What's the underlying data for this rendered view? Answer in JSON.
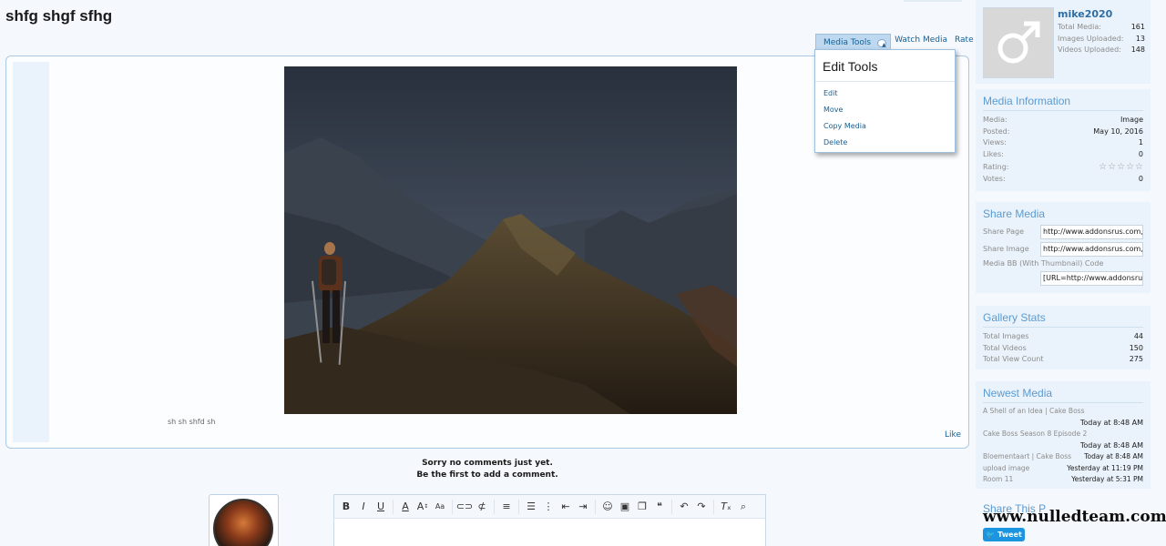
{
  "page": {
    "title": "shfg shgf sfhg"
  },
  "actions": {
    "media_tools": "Media Tools",
    "watch_media": "Watch Media",
    "rate_media": "Rate Media"
  },
  "media": {
    "caption": "sh sh shfd sh",
    "like": "Like"
  },
  "edit_tools": {
    "title": "Edit Tools",
    "items": [
      "Edit",
      "Move",
      "Copy Media",
      "Delete"
    ]
  },
  "comments": {
    "line1": "Sorry no comments just yet.",
    "line2": "Be the first to add a comment."
  },
  "author": {
    "name": "mike2020",
    "stats": [
      {
        "label": "Total Media:",
        "value": "161"
      },
      {
        "label": "Images Uploaded:",
        "value": "13"
      },
      {
        "label": "Videos Uploaded:",
        "value": "148"
      }
    ]
  },
  "media_info": {
    "title": "Media Information",
    "rows": [
      {
        "label": "Media:",
        "value": "Image"
      },
      {
        "label": "Posted:",
        "value": "May 10, 2016"
      },
      {
        "label": "Views:",
        "value": "1"
      },
      {
        "label": "Likes:",
        "value": "0"
      },
      {
        "label": "Rating:",
        "value": ""
      },
      {
        "label": "Votes:",
        "value": "0"
      }
    ],
    "rating_stars": 0,
    "rating_max": 5
  },
  "share_media": {
    "title": "Share Media",
    "share_page_label": "Share Page",
    "share_page_value": "http://www.addonsrus.com,",
    "share_image_label": "Share Image",
    "share_image_value": "http://www.addonsrus.com,",
    "bb_label": "Media BB (With Thumbnail) Code",
    "bb_value": "[URL=http://www.addonsru"
  },
  "gallery_stats": {
    "title": "Gallery Stats",
    "rows": [
      {
        "label": "Total Images",
        "value": "44"
      },
      {
        "label": "Total Videos",
        "value": "150"
      },
      {
        "label": "Total View Count",
        "value": "275"
      }
    ]
  },
  "newest_media": {
    "title": "Newest Media",
    "items": [
      {
        "title": "A Shell of an Idea | Cake Boss",
        "time": "Today at 8:48 AM"
      },
      {
        "title": "Cake Boss Season 8 Episode 2",
        "time": "Today at 8:48 AM"
      },
      {
        "title": "Bloementaart | Cake Boss",
        "time": "Today at 8:48 AM"
      },
      {
        "title": "upload image",
        "time": "Yesterday at 11:19 PM"
      },
      {
        "title": "Room 11",
        "time": "Yesterday at 5:31 PM"
      }
    ]
  },
  "share_this": {
    "title": "Share This P"
  },
  "tweet": {
    "label": "Tweet"
  },
  "watermark": "www.nulledteam.com",
  "editor": {
    "tools": [
      "bold-icon",
      "italic-icon",
      "underline-icon",
      "font-color-icon",
      "font-size-icon",
      "font-family-icon",
      "link-icon",
      "unlink-icon",
      "align-icon",
      "bullet-list-icon",
      "numbered-list-icon",
      "outdent-icon",
      "indent-icon",
      "smilie-icon",
      "image-icon",
      "media-icon",
      "quote-icon",
      "undo-icon",
      "redo-icon",
      "remove-format-icon",
      "toggle-bbcode-icon"
    ]
  }
}
